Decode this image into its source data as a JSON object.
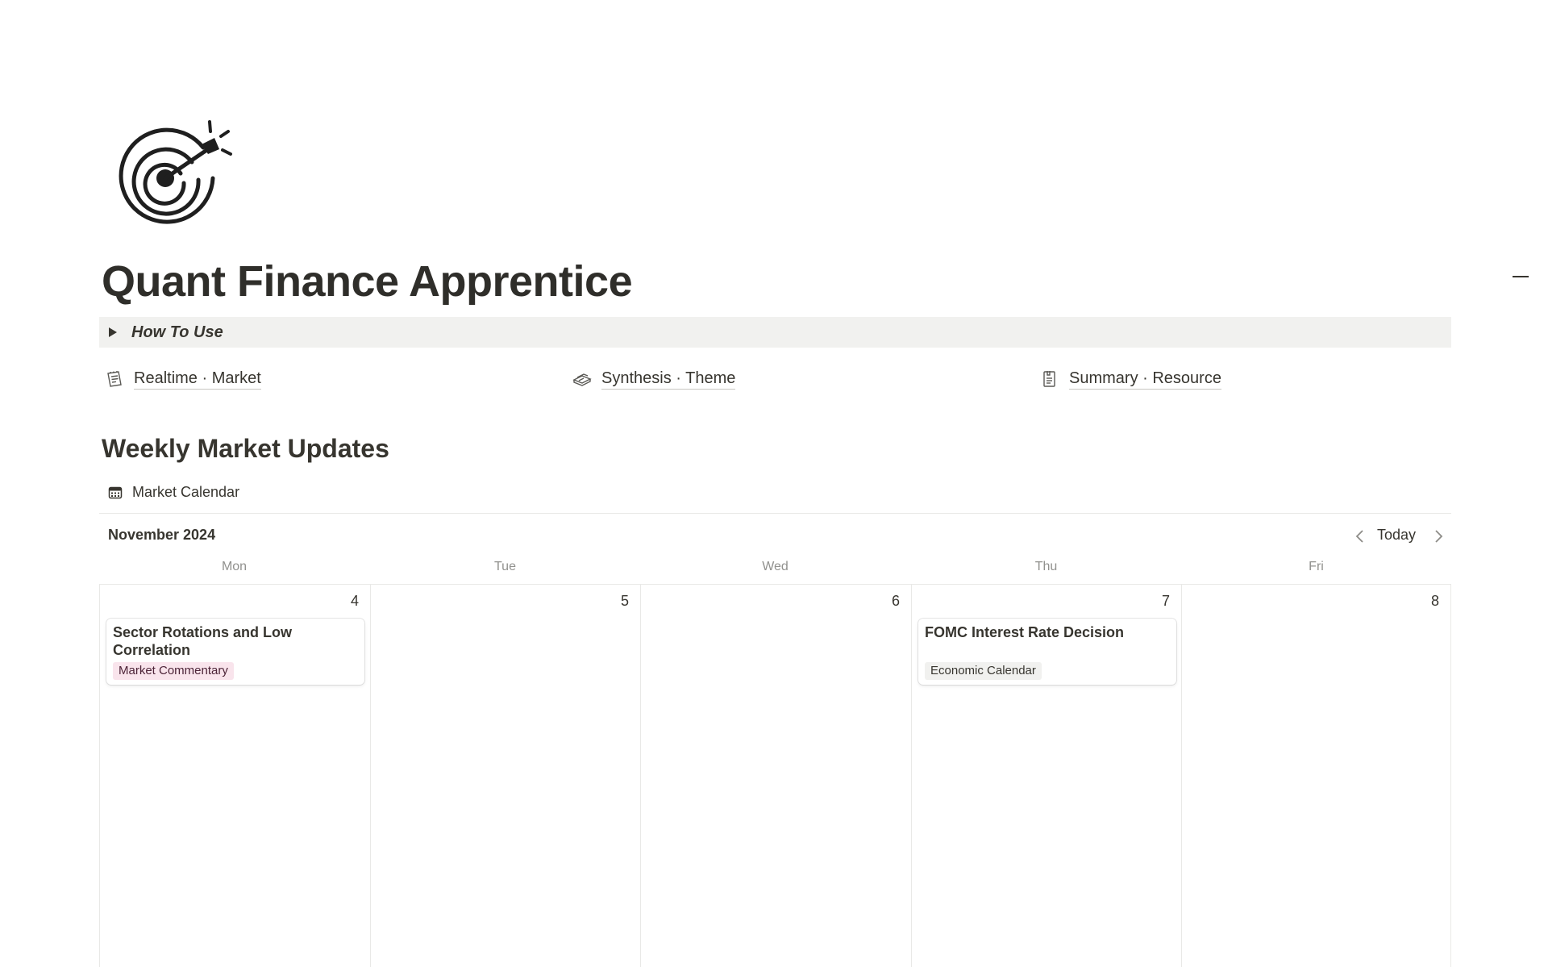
{
  "page": {
    "icon": "target-dart-icon",
    "title": "Quant Finance Apprentice"
  },
  "toggle": {
    "label": "How To Use"
  },
  "links": [
    {
      "icon": "notepad-icon",
      "label": "Realtime · Market"
    },
    {
      "icon": "box-stack-icon",
      "label": "Synthesis · Theme"
    },
    {
      "icon": "document-clip-icon",
      "label": "Summary · Resource"
    }
  ],
  "section": {
    "heading": "Weekly Market Updates"
  },
  "calendar": {
    "view_name": "Market Calendar",
    "view_icon": "calendar-icon",
    "month": "November 2024",
    "today_label": "Today",
    "weekdays": [
      "Mon",
      "Tue",
      "Wed",
      "Thu",
      "Fri"
    ],
    "days": [
      {
        "number": "4"
      },
      {
        "number": "5"
      },
      {
        "number": "6"
      },
      {
        "number": "7"
      },
      {
        "number": "8"
      }
    ],
    "events": [
      {
        "day_index": 0,
        "title": "Sector Rotations and Low Correlation",
        "tag": "Market Commentary",
        "tag_bg": "#f9e4ec",
        "tag_color": "#4c2337"
      },
      {
        "day_index": 3,
        "title": "FOMC Interest Rate Decision",
        "tag": "Economic Calendar",
        "tag_bg": "#f1f1ef",
        "tag_color": "#37352f"
      }
    ]
  }
}
